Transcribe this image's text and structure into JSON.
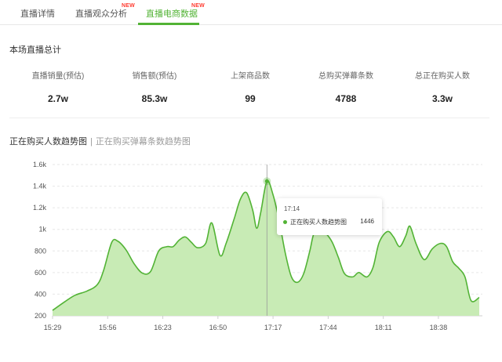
{
  "tabs": [
    {
      "label": "直播详情",
      "badge": ""
    },
    {
      "label": "直播观众分析",
      "badge": "NEW"
    },
    {
      "label": "直播电商数据",
      "badge": "NEW",
      "active": true
    }
  ],
  "summary": {
    "title": "本场直播总计",
    "stats": [
      {
        "label": "直播销量(预估)",
        "value": "2.7w"
      },
      {
        "label": "销售额(预估)",
        "value": "85.3w"
      },
      {
        "label": "上架商品数",
        "value": "99"
      },
      {
        "label": "总购买弹幕条数",
        "value": "4788"
      },
      {
        "label": "总正在购买人数",
        "value": "3.3w"
      }
    ]
  },
  "chart_switch": {
    "active": "正在购买人数趋势图",
    "separator": "|",
    "inactive": "正在购买弹幕条数趋势图"
  },
  "tooltip": {
    "time": "17:14",
    "series": "正在购买人数趋势图",
    "value": "1446"
  },
  "colors": {
    "accent": "#52b335",
    "fill": "#c8ebb5",
    "badge": "#ff3b30"
  },
  "chart_data": {
    "type": "area",
    "ylim": [
      200,
      1600
    ],
    "yticks": [
      "200",
      "400",
      "600",
      "800",
      "1k",
      "1.2k",
      "1.4k",
      "1.6k"
    ],
    "ytick_values": [
      200,
      400,
      600,
      800,
      1000,
      1200,
      1400,
      1600
    ],
    "xticks": [
      "15:29",
      "15:56",
      "16:23",
      "16:50",
      "17:17",
      "17:44",
      "18:11",
      "18:38"
    ],
    "x_minutes_start": 929,
    "x_minutes_end": 1138,
    "highlight_x": 1034,
    "series": [
      {
        "values": [
          [
            929,
            250
          ],
          [
            935,
            330
          ],
          [
            940,
            390
          ],
          [
            946,
            430
          ],
          [
            951,
            490
          ],
          [
            954,
            620
          ],
          [
            958,
            880
          ],
          [
            961,
            890
          ],
          [
            965,
            810
          ],
          [
            969,
            680
          ],
          [
            973,
            595
          ],
          [
            977,
            610
          ],
          [
            981,
            800
          ],
          [
            985,
            840
          ],
          [
            988,
            840
          ],
          [
            991,
            900
          ],
          [
            994,
            930
          ],
          [
            997,
            880
          ],
          [
            1000,
            830
          ],
          [
            1004,
            870
          ],
          [
            1007,
            1060
          ],
          [
            1011,
            760
          ],
          [
            1014,
            870
          ],
          [
            1018,
            1100
          ],
          [
            1021,
            1280
          ],
          [
            1024,
            1340
          ],
          [
            1027,
            1180
          ],
          [
            1029,
            1010
          ],
          [
            1031,
            1160
          ],
          [
            1034,
            1446
          ],
          [
            1037,
            1320
          ],
          [
            1040,
            1080
          ],
          [
            1043,
            780
          ],
          [
            1046,
            560
          ],
          [
            1049,
            510
          ],
          [
            1052,
            590
          ],
          [
            1055,
            800
          ],
          [
            1057,
            960
          ],
          [
            1060,
            1000
          ],
          [
            1063,
            960
          ],
          [
            1066,
            880
          ],
          [
            1069,
            740
          ],
          [
            1072,
            590
          ],
          [
            1076,
            560
          ],
          [
            1079,
            600
          ],
          [
            1083,
            560
          ],
          [
            1086,
            650
          ],
          [
            1089,
            880
          ],
          [
            1093,
            980
          ],
          [
            1096,
            930
          ],
          [
            1099,
            840
          ],
          [
            1102,
            940
          ],
          [
            1104,
            1030
          ],
          [
            1107,
            870
          ],
          [
            1111,
            720
          ],
          [
            1115,
            820
          ],
          [
            1119,
            870
          ],
          [
            1122,
            840
          ],
          [
            1125,
            700
          ],
          [
            1128,
            640
          ],
          [
            1131,
            560
          ],
          [
            1134,
            340
          ],
          [
            1138,
            370
          ]
        ]
      }
    ]
  }
}
